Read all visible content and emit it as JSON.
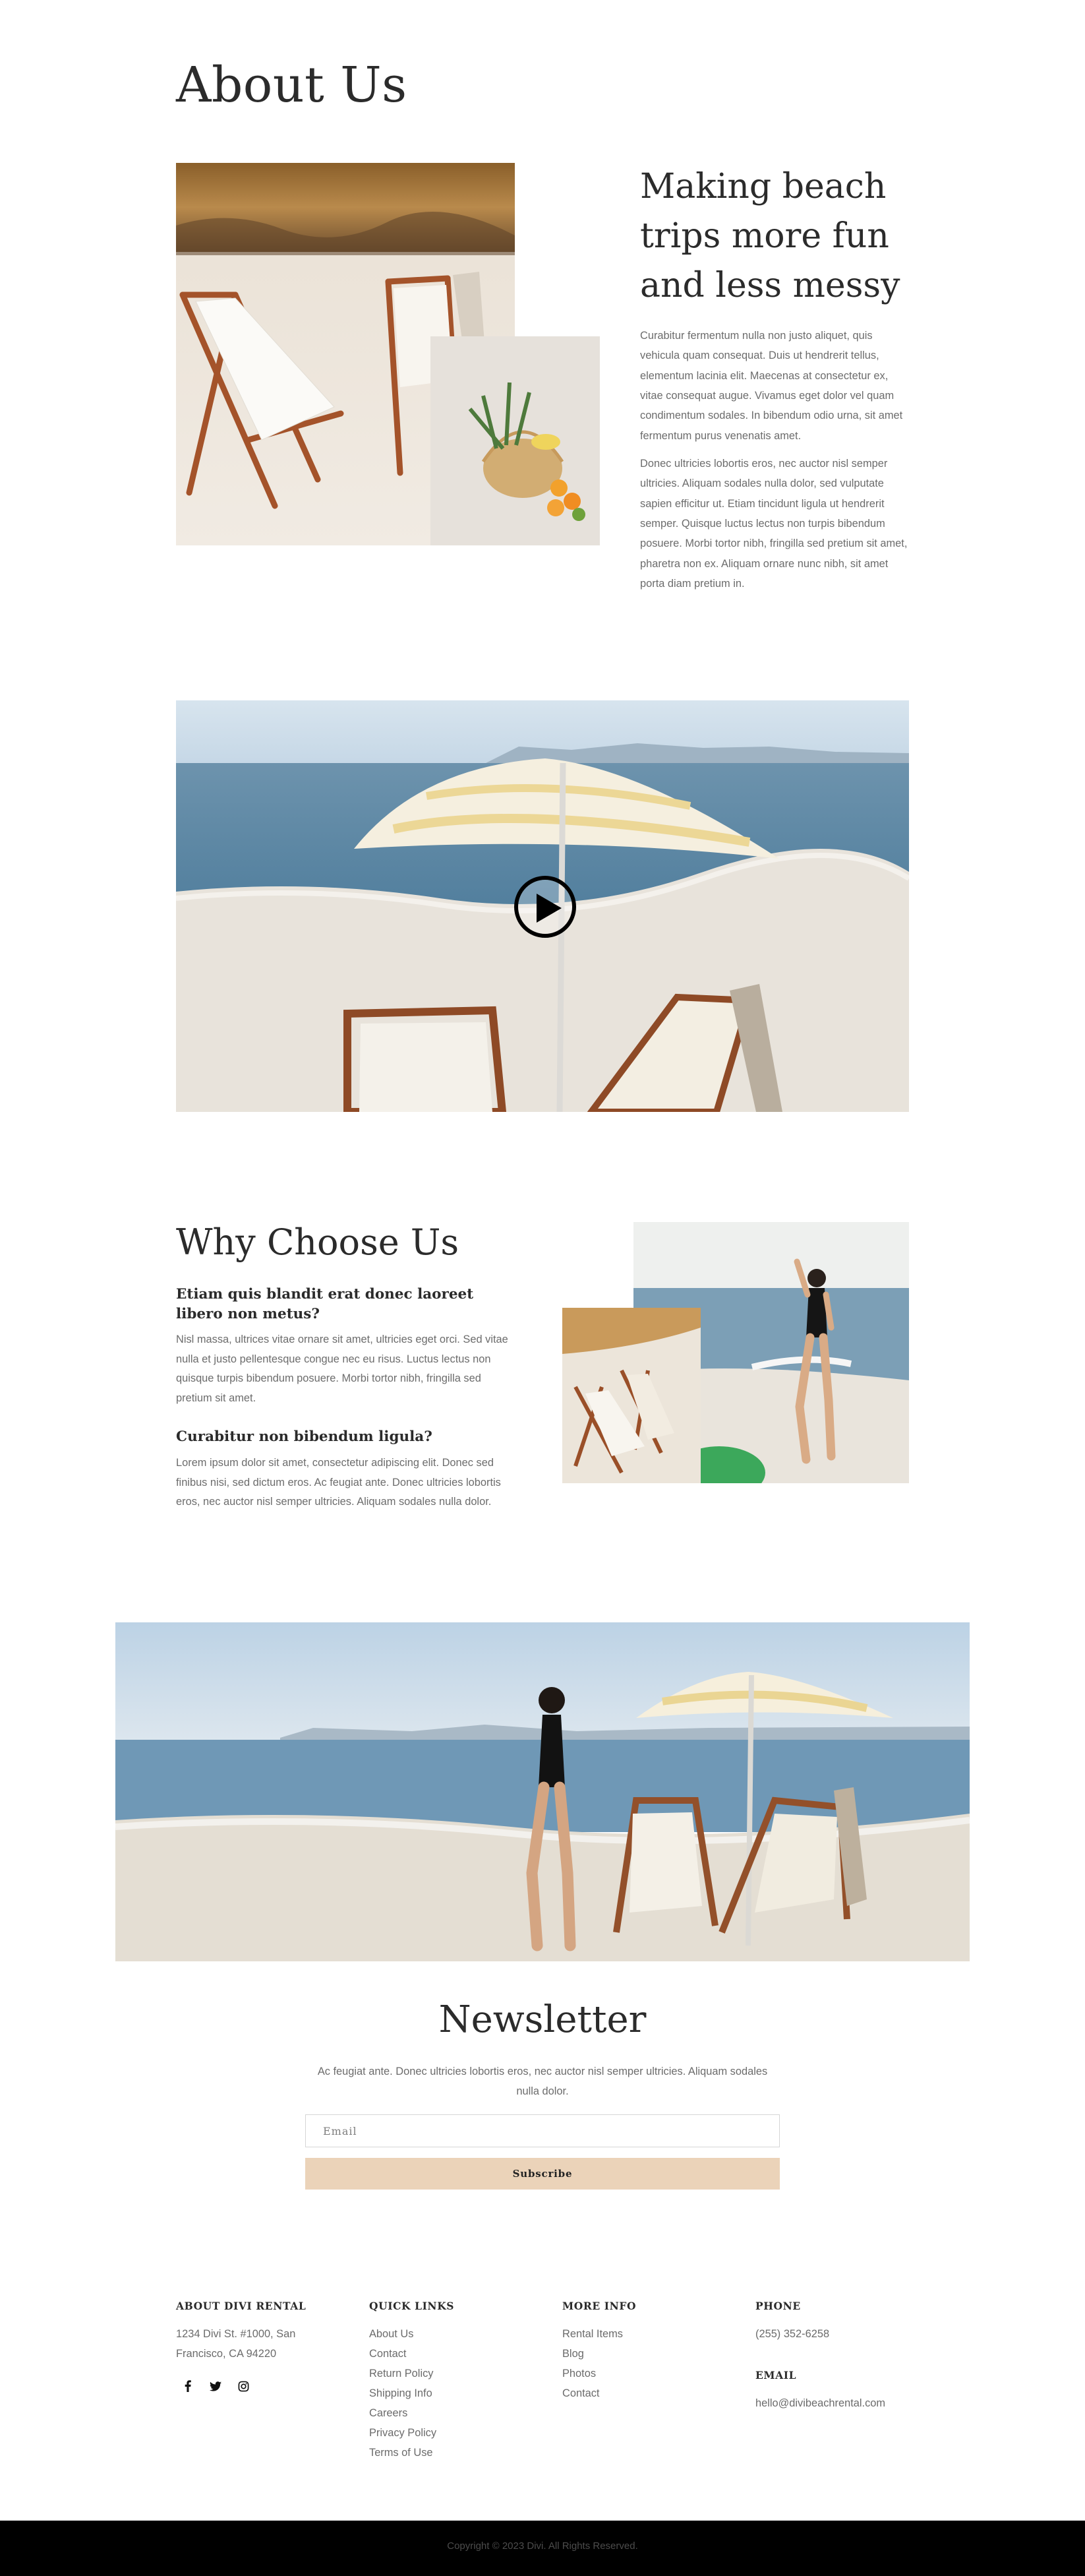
{
  "about": {
    "title": "About Us",
    "heading": "Making beach trips more fun and less messy",
    "p1": "Curabitur fermentum nulla non justo aliquet, quis vehicula quam consequat. Duis ut hendrerit tellus, elementum lacinia elit. Maecenas at consectetur ex, vitae consequat augue. Vivamus eget dolor vel quam condimentum sodales. In bibendum odio urna, sit amet fermentum purus venenatis amet.",
    "p2": "Donec ultricies lobortis eros, nec auctor nisl semper ultricies. Aliquam sodales nulla dolor, sed vulputate sapien efficitur ut. Etiam tincidunt ligula ut hendrerit semper. Quisque luctus lectus non turpis bibendum posuere. Morbi tortor nibh, fringilla sed pretium sit amet, pharetra non ex. Aliquam ornare nunc nibh, sit amet porta diam pretium in."
  },
  "video": {
    "play_icon": "play-icon"
  },
  "why": {
    "title": "Why Choose Us",
    "q1": "Etiam quis blandit erat donec laoreet libero non metus?",
    "a1": "Nisl massa, ultrices vitae ornare sit amet, ultricies eget orci. Sed vitae nulla et justo pellentesque congue nec eu risus. Luctus lectus non quisque turpis bibendum posuere. Morbi tortor nibh, fringilla sed pretium sit amet.",
    "q2": "Curabitur non bibendum ligula?",
    "a2": "Lorem ipsum dolor sit amet, consectetur adipiscing elit. Donec sed finibus nisi, sed dictum eros. Ac feugiat ante. Donec ultricies lobortis eros, nec auctor nisl semper ultricies. Aliquam sodales nulla dolor."
  },
  "newsletter": {
    "title": "Newsletter",
    "text": "Ac feugiat ante. Donec ultricies lobortis eros, nec auctor nisl semper ultricies. Aliquam sodales nulla dolor.",
    "email_placeholder": "Email",
    "subscribe_label": "Subscribe",
    "button_color": "#ebd3b9"
  },
  "footer": {
    "about": {
      "heading": "ABOUT DIVI RENTAL",
      "address_line1": "1234 Divi St. #1000, San",
      "address_line2": "Francisco, CA 94220",
      "social": [
        "facebook-icon",
        "twitter-icon",
        "instagram-icon"
      ]
    },
    "quick_links": {
      "heading": "QUICK LINKS",
      "items": [
        "About Us",
        "Contact",
        "Return Policy",
        "Shipping Info",
        "Careers",
        "Privacy Policy",
        "Terms of Use"
      ]
    },
    "more_info": {
      "heading": "MORE INFO",
      "items": [
        "Rental Items",
        "Blog",
        "Photos",
        "Contact"
      ]
    },
    "phone": {
      "heading": "PHONE",
      "number": "(255) 352-6258",
      "email_heading": "EMAIL",
      "email": "hello@divibeachrental.com"
    },
    "copyright": "Copyright © 2023 Divi. All Rights Reserved."
  }
}
